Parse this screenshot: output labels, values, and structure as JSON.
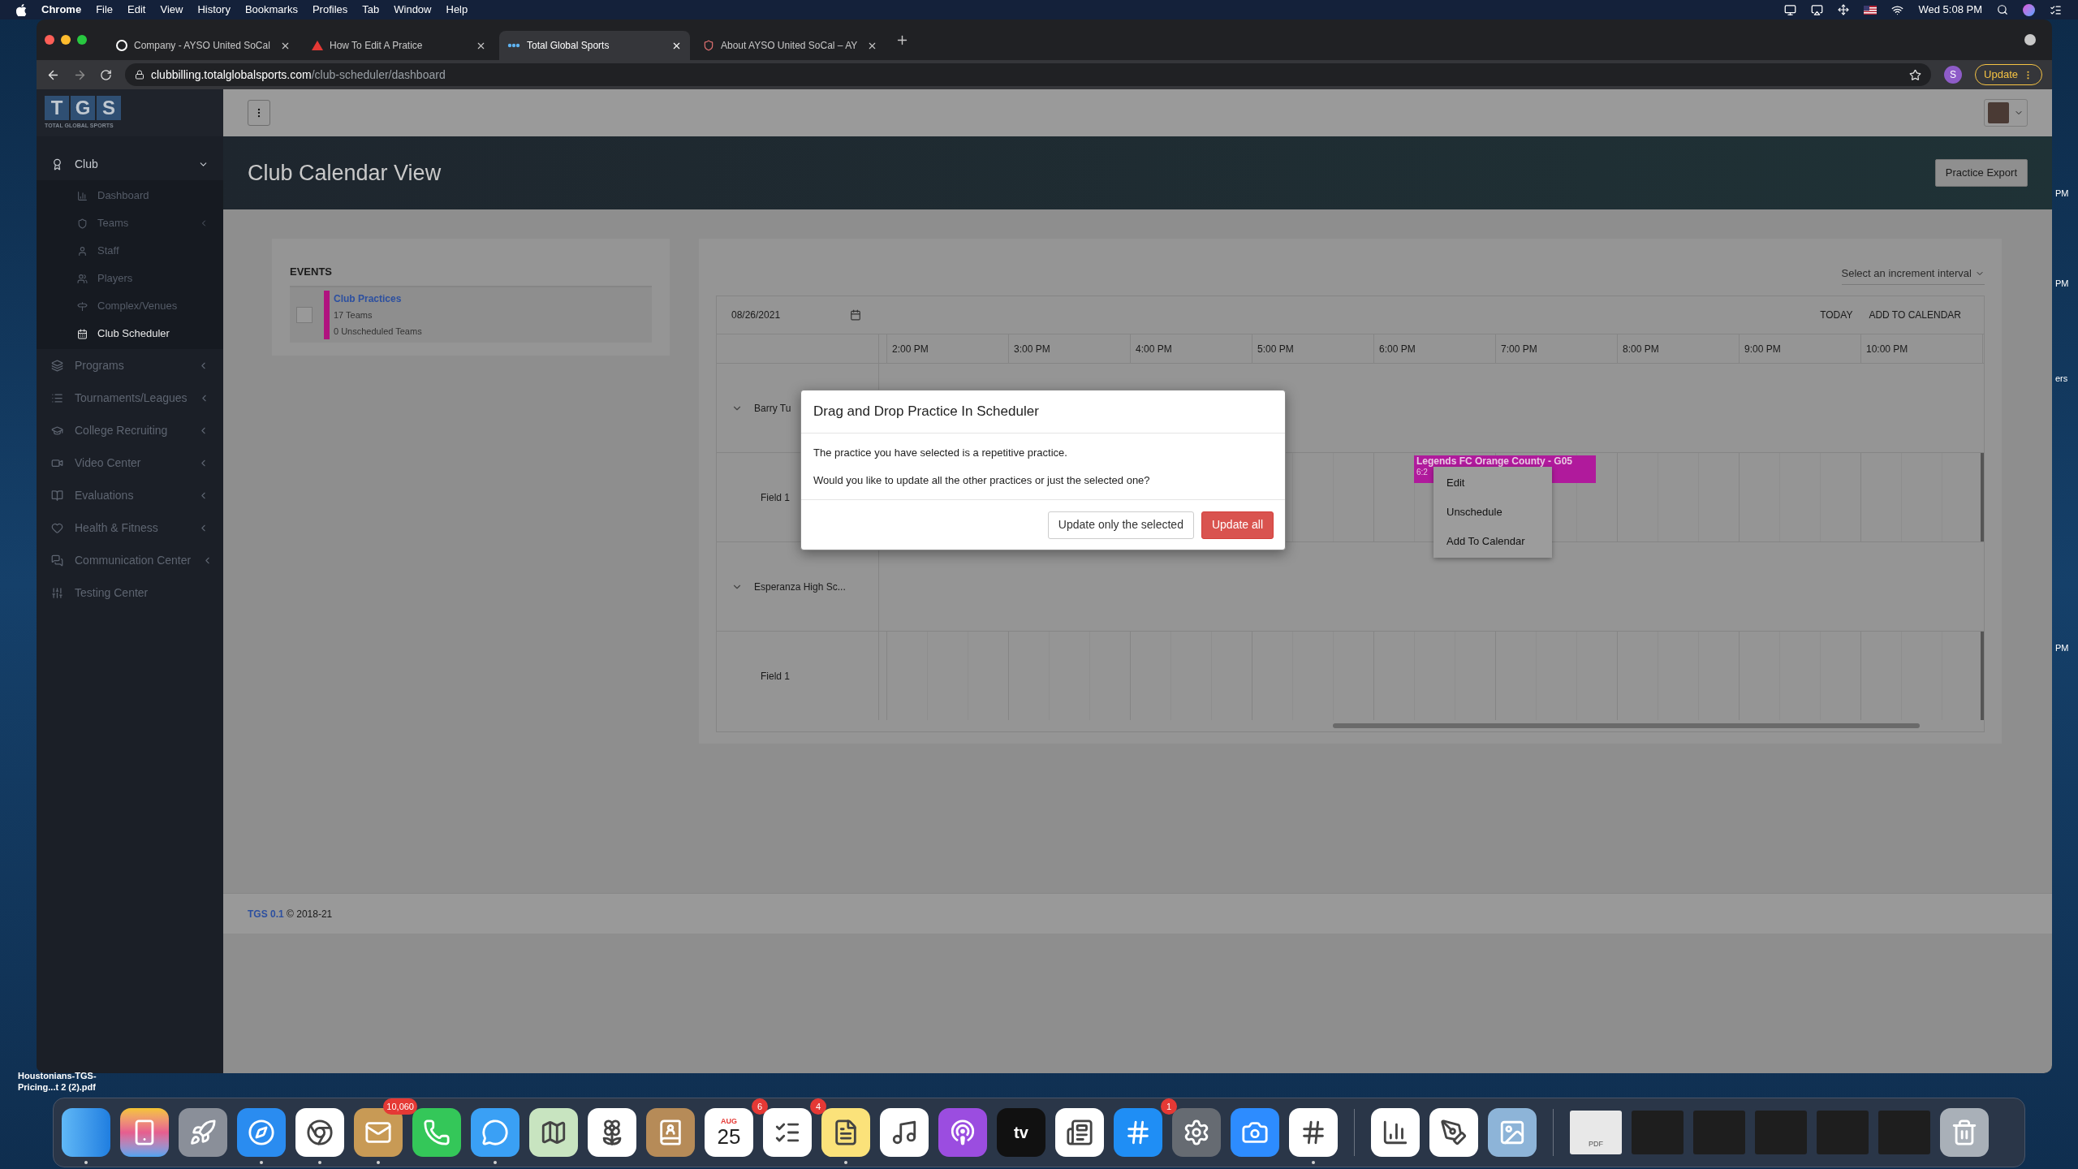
{
  "menubar": {
    "app": "Chrome",
    "menus": [
      "File",
      "Edit",
      "View",
      "History",
      "Bookmarks",
      "Profiles",
      "Tab",
      "Window",
      "Help"
    ],
    "clock": "Wed 5:08 PM"
  },
  "browser": {
    "tabs": [
      {
        "title": "Company - AYSO United SoCal",
        "selected": false
      },
      {
        "title": "How To Edit A Pratice",
        "selected": false
      },
      {
        "title": "Total Global Sports",
        "selected": true
      },
      {
        "title": "About AYSO United SoCal – AY",
        "selected": false
      }
    ],
    "url_host": "clubbilling.totalglobalsports.com",
    "url_path": "/club-scheduler/dashboard",
    "profile": "S",
    "update_button": "Update"
  },
  "logo": {
    "letters": [
      "T",
      "G",
      "S"
    ],
    "tagline": "TOTAL GLOBAL SPORTS"
  },
  "sidebar": {
    "items": [
      {
        "label": "Club",
        "expanded": true,
        "children": [
          {
            "label": "Dashboard",
            "selected": false
          },
          {
            "label": "Teams",
            "selected": false,
            "expanded": false
          },
          {
            "label": "Staff",
            "selected": false
          },
          {
            "label": "Players",
            "selected": false
          },
          {
            "label": "Complex/Venues",
            "selected": false
          },
          {
            "label": "Club Scheduler",
            "selected": true
          }
        ]
      },
      {
        "label": "Programs",
        "expanded": false
      },
      {
        "label": "Tournaments/Leagues",
        "expanded": false
      },
      {
        "label": "College Recruiting",
        "expanded": false
      },
      {
        "label": "Video Center",
        "expanded": false
      },
      {
        "label": "Evaluations",
        "expanded": false
      },
      {
        "label": "Health & Fitness",
        "expanded": false
      },
      {
        "label": "Communication Center",
        "expanded": false
      },
      {
        "label": "Testing Center"
      }
    ]
  },
  "header": {
    "title": "Club Calendar View",
    "export_button": "Practice Export"
  },
  "events": {
    "heading": "EVENTS",
    "items": [
      {
        "title": "Club Practices",
        "teams": "17 Teams",
        "unscheduled": "0 Unscheduled Teams",
        "checked": false
      }
    ]
  },
  "calendar": {
    "interval_placeholder": "Select an increment interval",
    "date": "08/26/2021",
    "today_button": "TODAY",
    "add_button": "ADD TO CALENDAR",
    "hours": [
      "2:00 PM",
      "3:00 PM",
      "4:00 PM",
      "5:00 PM",
      "6:00 PM",
      "7:00 PM",
      "8:00 PM",
      "9:00 PM",
      "10:00 PM"
    ],
    "groups": [
      {
        "name": "Barry Tu",
        "expanded": true,
        "fields": [
          {
            "name": "Field 1",
            "events": [
              {
                "title": "Legends FC Orange County - G05",
                "time": "6:2"
              }
            ]
          }
        ]
      },
      {
        "name": "Esperanza High Sc...",
        "expanded": true,
        "fields": [
          {
            "name": "Field 1"
          }
        ]
      }
    ]
  },
  "context_menu": {
    "items": [
      "Edit",
      "Unschedule",
      "Add To Calendar"
    ]
  },
  "modal": {
    "title": "Drag and Drop Practice In Scheduler",
    "lines": [
      "The practice you have selected is a repetitive practice.",
      "Would you like to update all the other practices or just the selected one?"
    ],
    "buttons": [
      {
        "label": "Update only the selected",
        "kind": "secondary"
      },
      {
        "label": "Update all",
        "kind": "primary"
      }
    ]
  },
  "footer": {
    "version": "TGS 0.1",
    "copyright": "© 2018-21"
  },
  "desktop": {
    "file_label": [
      "Houstonians-TGS-",
      "Pricing...t 2 (2).pdf"
    ],
    "edge_labels": [
      "PM",
      "PM",
      "ers",
      "PM"
    ]
  },
  "dock": {
    "apps": [
      {
        "kind": "finder",
        "running": true
      },
      {
        "kind": "phone",
        "running": false
      },
      {
        "kind": "rocket",
        "running": false
      },
      {
        "kind": "safari",
        "running": true
      },
      {
        "kind": "chrome",
        "running": true
      },
      {
        "kind": "mail",
        "running": true,
        "badge": "10,060"
      },
      {
        "kind": "facetime",
        "running": false
      },
      {
        "kind": "messages",
        "running": true
      },
      {
        "kind": "maps",
        "running": false
      },
      {
        "kind": "photos",
        "running": false
      },
      {
        "kind": "contacts",
        "running": false
      },
      {
        "kind": "calendar",
        "running": false,
        "badge": "6",
        "month": "AUG",
        "day": "25"
      },
      {
        "kind": "reminders",
        "running": false,
        "badge": "4"
      },
      {
        "kind": "notes",
        "running": true
      },
      {
        "kind": "music",
        "running": false
      },
      {
        "kind": "podcasts",
        "running": false
      },
      {
        "kind": "tv",
        "running": false,
        "text": "tv"
      },
      {
        "kind": "news",
        "running": false
      },
      {
        "kind": "appstore",
        "running": false,
        "badge": "1"
      },
      {
        "kind": "settings",
        "running": false
      },
      {
        "kind": "zoom",
        "running": false
      },
      {
        "kind": "slack",
        "running": true
      },
      {
        "kind": "separator"
      },
      {
        "kind": "numbers",
        "running": false
      },
      {
        "kind": "pages",
        "running": false
      },
      {
        "kind": "preview",
        "running": false
      },
      {
        "kind": "separator"
      },
      {
        "kind": "document",
        "text": "PDF"
      },
      {
        "kind": "thumbnail"
      },
      {
        "kind": "thumbnail"
      },
      {
        "kind": "thumbnail"
      },
      {
        "kind": "thumbnail"
      },
      {
        "kind": "thumbnail"
      },
      {
        "kind": "trash",
        "running": false
      }
    ]
  }
}
